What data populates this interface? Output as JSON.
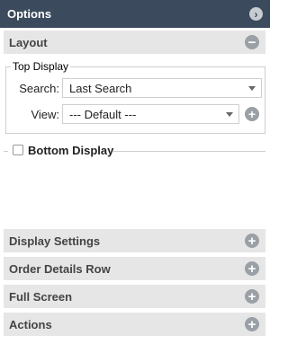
{
  "panel": {
    "title": "Options",
    "collapse_icon": "chevron-right-icon"
  },
  "layout_section": {
    "title": "Layout",
    "toggle_icon": "minus-circle-icon"
  },
  "top_display": {
    "legend": "Top Display",
    "search_label": "Search:",
    "search_value": "Last Search",
    "view_label": "View:",
    "view_value": "--- Default ---",
    "add_icon": "plus-circle-icon"
  },
  "bottom_display": {
    "label": "Bottom Display",
    "checked": false
  },
  "sections": [
    {
      "title": "Display Settings",
      "toggle_icon": "plus-circle-icon"
    },
    {
      "title": "Order Details Row",
      "toggle_icon": "plus-circle-icon"
    },
    {
      "title": "Full Screen",
      "toggle_icon": "plus-circle-icon"
    },
    {
      "title": "Actions",
      "toggle_icon": "plus-circle-icon"
    }
  ],
  "colors": {
    "titlebar": "#3b4a5d",
    "section_header": "#e6e6e6",
    "icon_gray": "#9aa0a6"
  }
}
